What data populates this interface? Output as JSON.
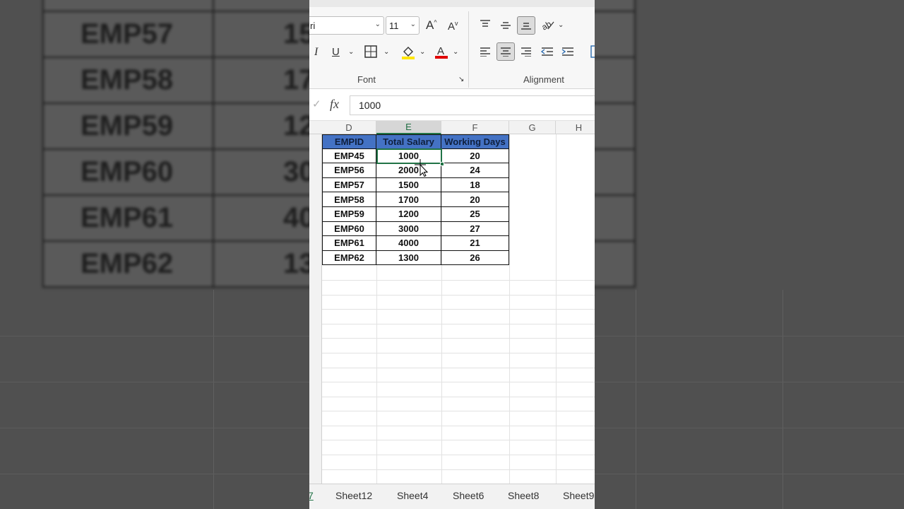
{
  "background": {
    "rows": [
      {
        "id": "EMP57",
        "partial": "15"
      },
      {
        "id": "EMP58",
        "partial": "17"
      },
      {
        "id": "EMP59",
        "partial": "12"
      },
      {
        "id": "EMP60",
        "partial": "30"
      },
      {
        "id": "EMP61",
        "partial": "40"
      },
      {
        "id": "EMP62",
        "partial": "13"
      }
    ]
  },
  "ribbon": {
    "font_name": "ri",
    "font_size": "11",
    "font_group": "Font",
    "alignment_group": "Alignment",
    "italic": "I",
    "underline": "U"
  },
  "formula_bar": {
    "fx": "fx",
    "value": "1000"
  },
  "columns": [
    "D",
    "E",
    "F",
    "G",
    "H"
  ],
  "table": {
    "headers": [
      "EMPID",
      "Total Salary",
      "Working Days"
    ],
    "rows": [
      [
        "EMP45",
        "1000",
        "20"
      ],
      [
        "EMP56",
        "2000",
        "24"
      ],
      [
        "EMP57",
        "1500",
        "18"
      ],
      [
        "EMP58",
        "1700",
        "20"
      ],
      [
        "EMP59",
        "1200",
        "25"
      ],
      [
        "EMP60",
        "3000",
        "27"
      ],
      [
        "EMP61",
        "4000",
        "21"
      ],
      [
        "EMP62",
        "1300",
        "26"
      ]
    ]
  },
  "sheet_tabs": [
    "7",
    "Sheet12",
    "Sheet4",
    "Sheet6",
    "Sheet8",
    "Sheet9"
  ],
  "colors": {
    "header_fill": "#4472c4",
    "selection": "#217346"
  }
}
